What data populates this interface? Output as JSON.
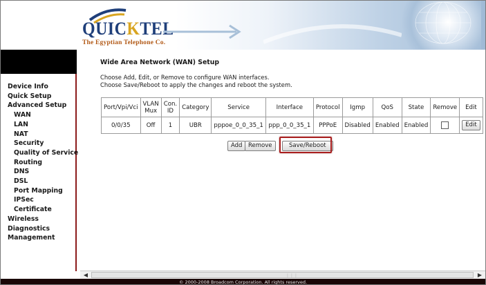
{
  "brand": {
    "logo_text_a": "QUIC",
    "logo_text_k": "K",
    "logo_text_b": "TEL",
    "tagline": "The Egyptian Telephone Co."
  },
  "sidebar": {
    "items": [
      {
        "label": "Device Info",
        "level": 0
      },
      {
        "label": "Quick Setup",
        "level": 0
      },
      {
        "label": "Advanced Setup",
        "level": 0
      },
      {
        "label": "WAN",
        "level": 1
      },
      {
        "label": "LAN",
        "level": 1
      },
      {
        "label": "NAT",
        "level": 1
      },
      {
        "label": "Security",
        "level": 1
      },
      {
        "label": "Quality of Service",
        "level": 1
      },
      {
        "label": "Routing",
        "level": 1
      },
      {
        "label": "DNS",
        "level": 1
      },
      {
        "label": "DSL",
        "level": 1
      },
      {
        "label": "Port Mapping",
        "level": 1
      },
      {
        "label": "IPSec",
        "level": 1
      },
      {
        "label": "Certificate",
        "level": 1
      },
      {
        "label": "Wireless",
        "level": 0
      },
      {
        "label": "Diagnostics",
        "level": 0
      },
      {
        "label": "Management",
        "level": 0
      }
    ]
  },
  "main": {
    "title": "Wide Area Network (WAN) Setup",
    "description_line1": "Choose Add, Edit, or Remove to configure WAN interfaces.",
    "description_line2": "Choose Save/Reboot to apply the changes and reboot the system.",
    "table": {
      "headers": {
        "port": "Port/Vpi/Vci",
        "vlan_a": "VLAN",
        "vlan_b": "Mux",
        "con_a": "Con.",
        "con_b": "ID",
        "category": "Category",
        "service": "Service",
        "interface": "Interface",
        "protocol": "Protocol",
        "igmp": "Igmp",
        "qos": "QoS",
        "state": "State",
        "remove": "Remove",
        "edit": "Edit"
      },
      "rows": [
        {
          "port": "0/0/35",
          "vlan_mux": "Off",
          "con_id": "1",
          "category": "UBR",
          "service": "pppoe_0_0_35_1",
          "interface": "ppp_0_0_35_1",
          "protocol": "PPPoE",
          "igmp": "Disabled",
          "qos": "Enabled",
          "state": "Enabled",
          "remove_checked": false,
          "edit_label": "Edit"
        }
      ]
    },
    "buttons": {
      "add": "Add",
      "remove": "Remove",
      "save_reboot": "Save/Reboot"
    },
    "highlight_color": "#a81e1e"
  },
  "footer": {
    "copyright": "© 2000-2008 Broadcom Corporation. All rights reserved."
  }
}
